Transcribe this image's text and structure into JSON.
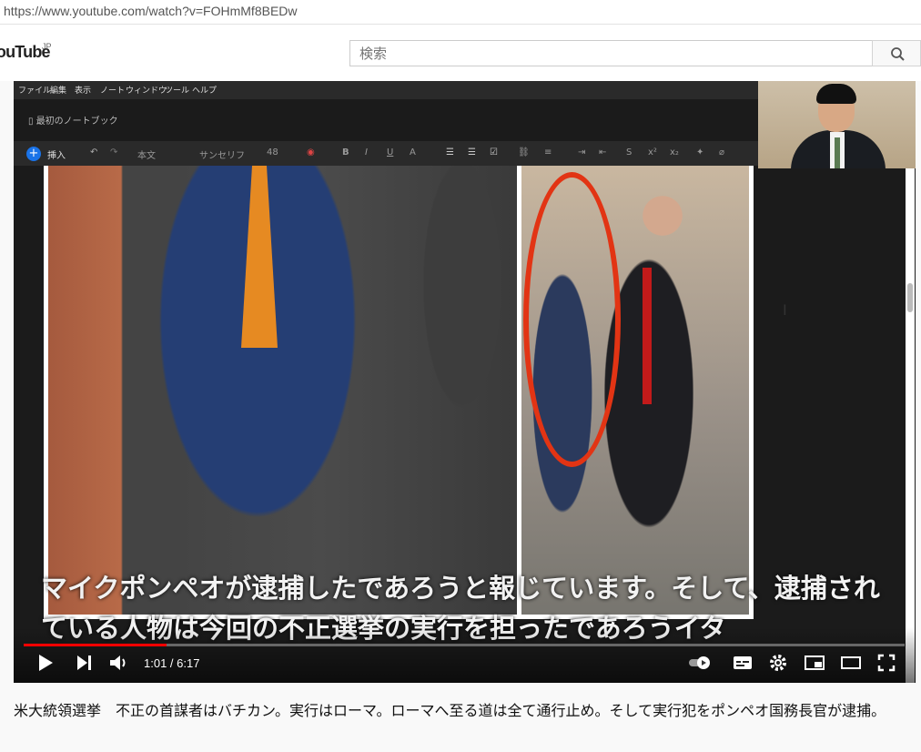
{
  "browser": {
    "url": "https://www.youtube.com/watch?v=FOHmMf8BEDw"
  },
  "header": {
    "logo": "YouTube",
    "logo_region": "JP",
    "search_placeholder": "検索"
  },
  "editor": {
    "menu": [
      "ファイル",
      "編集",
      "表示",
      "ノート",
      "ウィンドウ",
      "ツール",
      "ヘルプ"
    ],
    "notebook": "最初のノートブック",
    "toolbar": {
      "insert": "挿入",
      "style": "本文",
      "font": "サンセリフ",
      "size": "48"
    }
  },
  "video": {
    "caption": "マイクポンペオが逮捕したであろうと報じています。そして、逮捕されている人物は今回の不正選挙の実行を担ったであろうイタ",
    "time": "1:01 / 6:17",
    "progress_fraction": 0.162
  },
  "title": "米大統領選挙　不正の首謀者はバチカン。実行はローマ。ローマへ至る道は全て通行止め。そして実行犯をポンペオ国務長官が逮捕。"
}
